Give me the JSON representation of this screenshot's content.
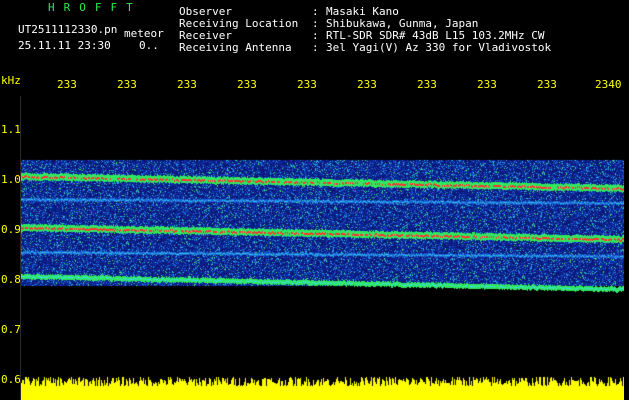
{
  "header": {
    "app_title": "HROFFT",
    "file_name": "UT2511112330.pn",
    "meteor_label": "meteor",
    "date_time": "25.11.11 23:30",
    "count": "0..",
    "info": [
      {
        "key": "Observer",
        "sep": ":",
        "value": "Masaki Kano"
      },
      {
        "key": "Receiving Location",
        "sep": ":",
        "value": "Shibukawa, Gunma, Japan"
      },
      {
        "key": "Receiver",
        "sep": ":",
        "value": "RTL-SDR SDR# 43dB L15 103.2MHz CW"
      },
      {
        "key": "Receiving Antenna",
        "sep": ":",
        "value": "3el Yagi(V) Az 330 for Vladivostok"
      }
    ]
  },
  "plot": {
    "unit_label": "kHz",
    "x_ticks": [
      "233",
      "233",
      "233",
      "233",
      "233",
      "233",
      "233",
      "233",
      "233",
      "2340"
    ],
    "y_ticks": [
      "1.1",
      "1.0",
      "0.9",
      "0.8",
      "0.7",
      "0.6"
    ]
  },
  "colors": {
    "header_green": "#2ee84a",
    "header_white": "#ffffff",
    "tick_yellow": "#ffff00",
    "background": "#000000",
    "noise_floor": "#10208a",
    "trace_red": "#ff3030",
    "amplitude_yellow": "#ffff00"
  }
}
